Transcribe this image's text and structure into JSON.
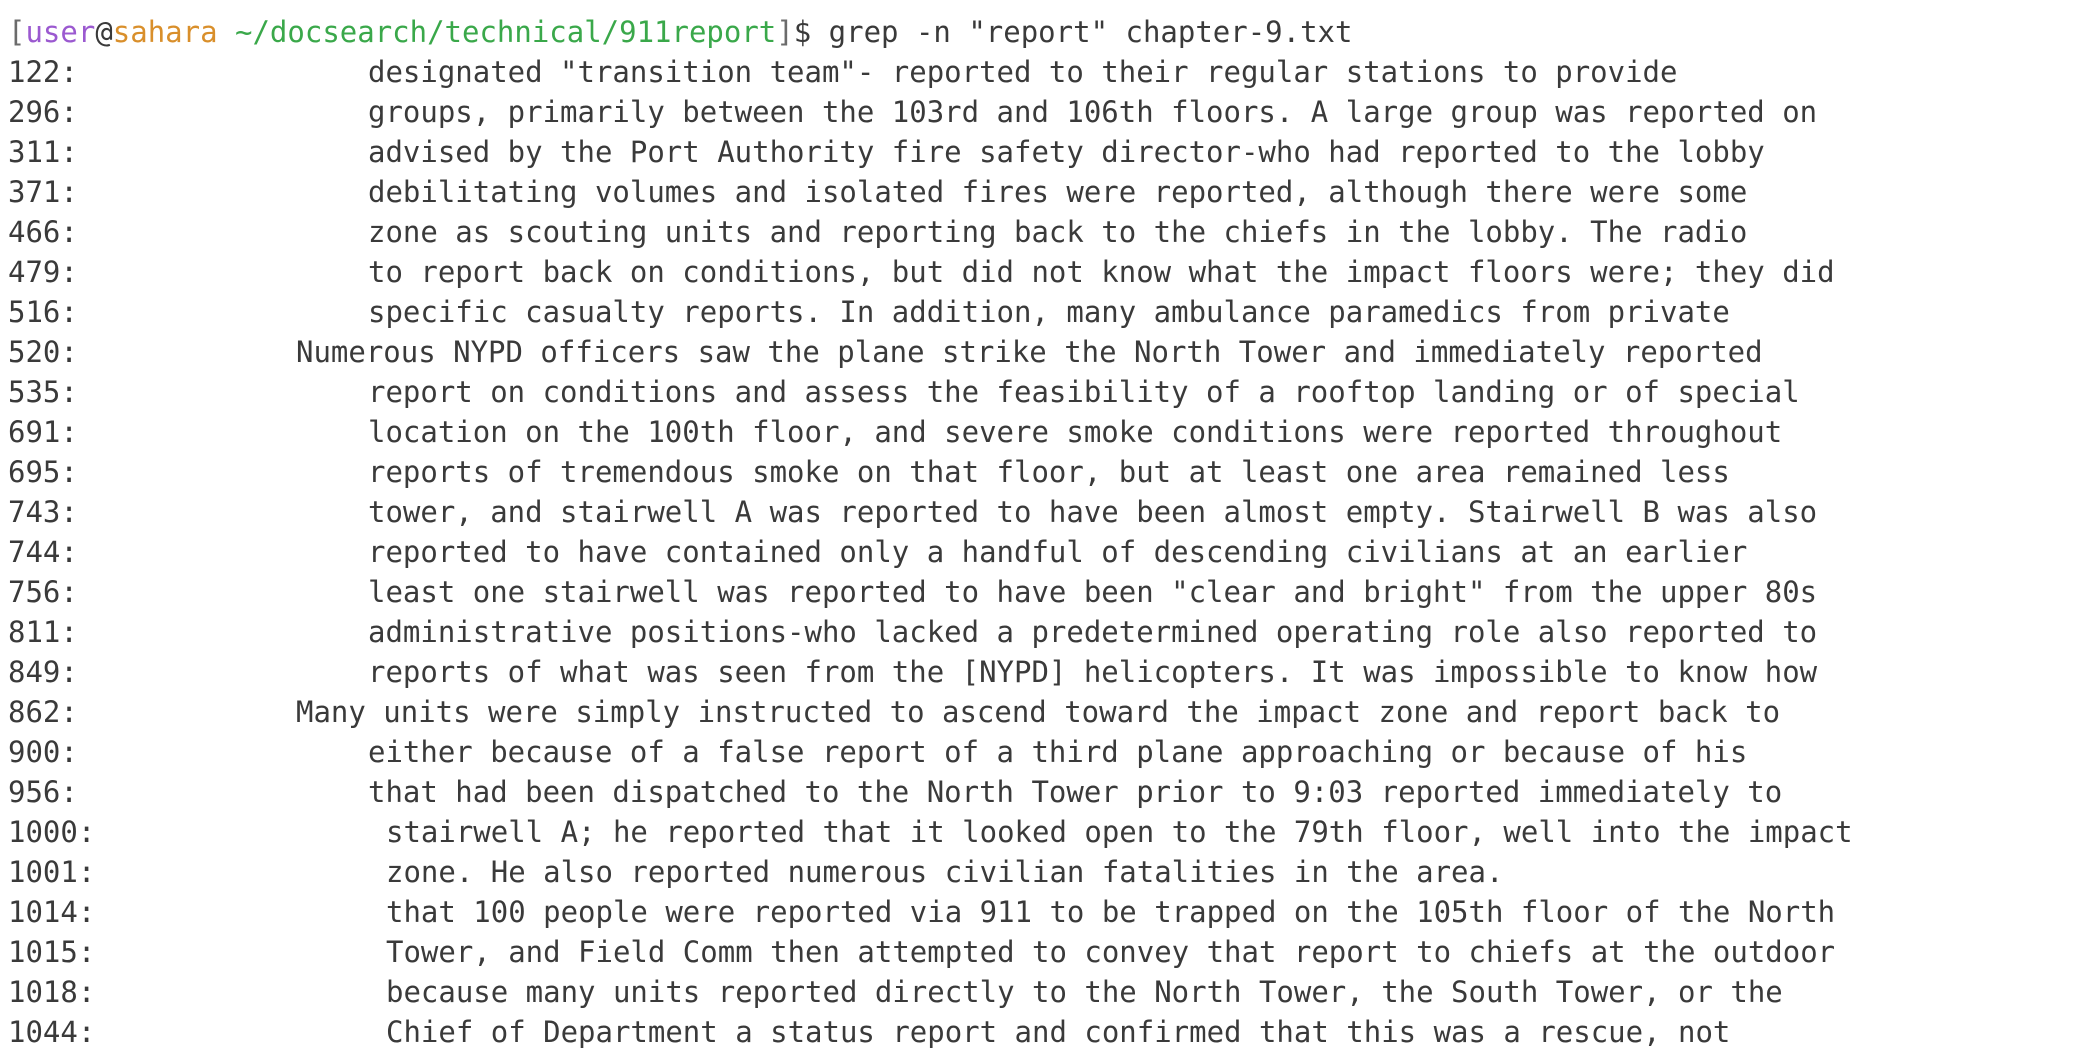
{
  "prompt": {
    "open_bracket": "[",
    "user": "user",
    "at": "@",
    "host": "sahara",
    "path": "~/docsearch/technical/911report",
    "close_bracket": "]",
    "dollar": "$",
    "command": "grep -n \"report\" chapter-9.txt"
  },
  "colors": {
    "user": "#9b59d0",
    "host": "#d98f2b",
    "path": "#3aa84a",
    "text": "#3a3a3a"
  },
  "output": [
    {
      "num": "122:",
      "text": "designated \"transition team\"- reported to their regular stations to provide",
      "style": "a"
    },
    {
      "num": "296:",
      "text": "groups, primarily between the 103rd and 106th floors. A large group was reported on",
      "style": "a"
    },
    {
      "num": "311:",
      "text": "advised by the Port Authority fire safety director-who had reported to the lobby",
      "style": "a"
    },
    {
      "num": "371:",
      "text": "debilitating volumes and isolated fires were reported, although there were some",
      "style": "a"
    },
    {
      "num": "466:",
      "text": "zone as scouting units and reporting back to the chiefs in the lobby. The radio",
      "style": "a"
    },
    {
      "num": "479:",
      "text": "to report back on conditions, but did not know what the impact floors were; they did",
      "style": "a"
    },
    {
      "num": "516:",
      "text": "specific casualty reports. In addition, many ambulance paramedics from private",
      "style": "a"
    },
    {
      "num": "520:",
      "text": "Numerous NYPD officers saw the plane strike the North Tower and immediately reported",
      "style": "b"
    },
    {
      "num": "535:",
      "text": "report on conditions and assess the feasibility of a rooftop landing or of special",
      "style": "a"
    },
    {
      "num": "691:",
      "text": "location on the 100th floor, and severe smoke conditions were reported throughout",
      "style": "a"
    },
    {
      "num": "695:",
      "text": "reports of tremendous smoke on that floor, but at least one area remained less",
      "style": "a"
    },
    {
      "num": "743:",
      "text": "tower, and stairwell A was reported to have been almost empty. Stairwell B was also",
      "style": "a"
    },
    {
      "num": "744:",
      "text": "reported to have contained only a handful of descending civilians at an earlier",
      "style": "a"
    },
    {
      "num": "756:",
      "text": "least one stairwell was reported to have been \"clear and bright\" from the upper 80s",
      "style": "a"
    },
    {
      "num": "811:",
      "text": "administrative positions-who lacked a predetermined operating role also reported to",
      "style": "a"
    },
    {
      "num": "849:",
      "text": "reports of what was seen from the [NYPD] helicopters. It was impossible to know how",
      "style": "a"
    },
    {
      "num": "862:",
      "text": "Many units were simply instructed to ascend toward the impact zone and report back to",
      "style": "b"
    },
    {
      "num": "900:",
      "text": "either because of a false report of a third plane approaching or because of his",
      "style": "a"
    },
    {
      "num": "956:",
      "text": "that had been dispatched to the North Tower prior to 9:03 reported immediately to",
      "style": "a"
    },
    {
      "num": "1000:",
      "text": "stairwell A; he reported that it looked open to the 79th floor, well into the impact",
      "style": "c"
    },
    {
      "num": "1001:",
      "text": "zone. He also reported numerous civilian fatalities in the area.",
      "style": "c"
    },
    {
      "num": "1014:",
      "text": "that 100 people were reported via 911 to be trapped on the 105th floor of the North",
      "style": "c"
    },
    {
      "num": "1015:",
      "text": "Tower, and Field Comm then attempted to convey that report to chiefs at the outdoor",
      "style": "c"
    },
    {
      "num": "1018:",
      "text": "because many units reported directly to the North Tower, the South Tower, or the",
      "style": "c"
    },
    {
      "num": "1044:",
      "text": "Chief of Department a status report and confirmed that this was a rescue, not",
      "style": "c"
    }
  ]
}
